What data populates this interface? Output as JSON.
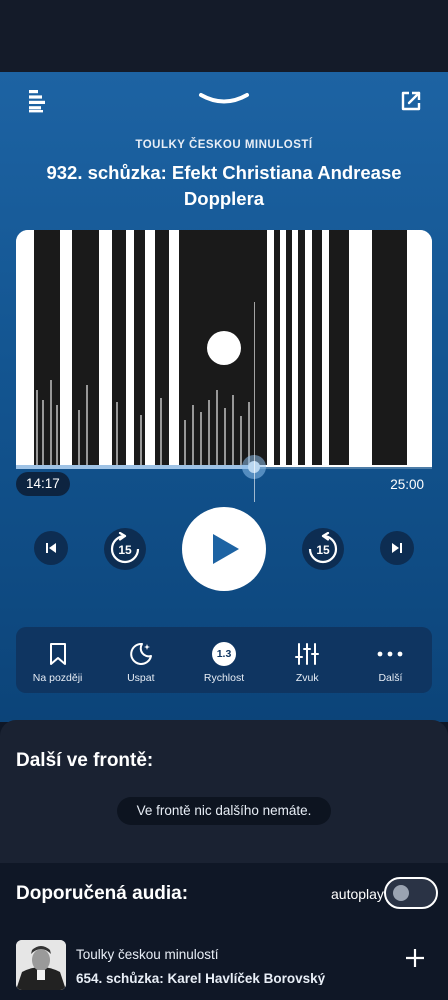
{
  "header": {
    "logo_icon": "radio-logo-icon",
    "collapse_icon": "chevron-down-icon",
    "share_icon": "external-share-icon"
  },
  "episode": {
    "show_name": "TOULKY ČESKOU MINULOSTÍ",
    "title": "932. schůzka: Efekt Christiana Andrease Dopplera"
  },
  "progress": {
    "elapsed": "14:17",
    "total": "25:00",
    "fraction": 0.5713
  },
  "controls": {
    "rewind_seconds": "15",
    "forward_seconds": "15",
    "icons": [
      "skip-previous-icon",
      "rewind-15-icon",
      "play-icon",
      "forward-15-icon",
      "skip-next-icon"
    ]
  },
  "toolbar": {
    "later_label": "Na později",
    "sleep_label": "Uspat",
    "speed_value": "1.3",
    "speed_label": "Rychlost",
    "sound_label": "Zvuk",
    "more_label": "Další"
  },
  "queue": {
    "title": "Další ve frontě:",
    "empty_text": "Ve frontě nic dalšího nemáte."
  },
  "recommended": {
    "title": "Doporučená audia:",
    "autoplay_label": "autoplay",
    "autoplay_on": false,
    "items": [
      {
        "show": "Toulky českou minulostí",
        "subtitle": "654. schůzka: Karel Havlíček Borovský"
      }
    ]
  },
  "colors": {
    "player_gradient_top": "#1d63a3",
    "player_gradient_bottom": "#0c4479",
    "panel": "#1a2232",
    "background": "#0f1726"
  }
}
